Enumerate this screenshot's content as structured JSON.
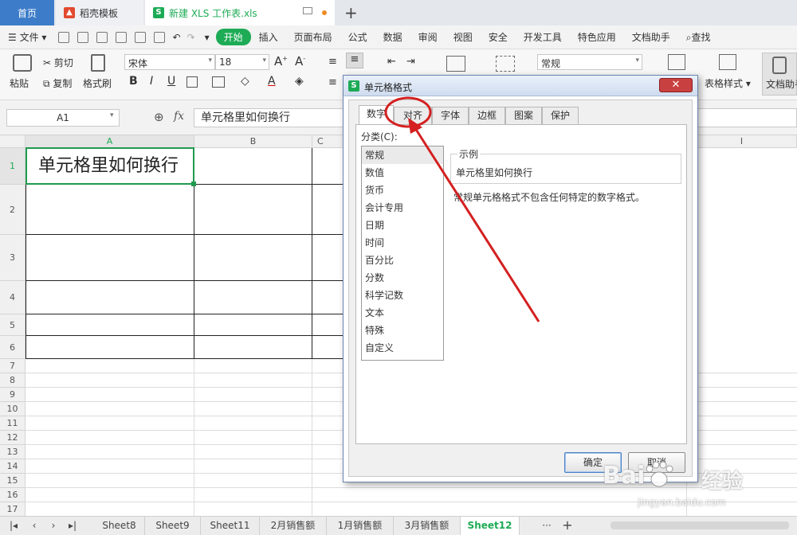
{
  "tabs": [
    {
      "label": "首页"
    },
    {
      "label": "稻壳模板"
    },
    {
      "label": "新建 XLS 工作表.xls"
    }
  ],
  "menu": {
    "file": "文件",
    "items": [
      "开始",
      "插入",
      "页面布局",
      "公式",
      "数据",
      "审阅",
      "视图",
      "安全",
      "开发工具",
      "特色应用",
      "文档助手"
    ],
    "search": "查找"
  },
  "ribbon": {
    "paste": "粘贴",
    "cut": "剪切",
    "copy": "复制",
    "format_painter": "格式刷",
    "font_name": "宋体",
    "font_size": "18",
    "bold": "B",
    "italic": "I",
    "underline": "U",
    "number_format": "常规",
    "table_style": "表格样式",
    "doc_helper": "文档助手"
  },
  "formula_bar": {
    "name_box": "A1",
    "fx": "fx",
    "content": "单元格里如何换行"
  },
  "grid": {
    "columns": [
      "A",
      "B",
      "C",
      "I"
    ],
    "rows": [
      "1",
      "2",
      "3",
      "4",
      "5",
      "6",
      "7",
      "8",
      "9",
      "10",
      "11",
      "12",
      "13",
      "14",
      "15",
      "16",
      "17"
    ],
    "a1_value": "单元格里如何换行"
  },
  "sheets": [
    "Sheet8",
    "Sheet9",
    "Sheet11",
    "2月销售额",
    "1月销售额",
    "3月销售额",
    "Sheet12"
  ],
  "dialog": {
    "title": "单元格格式",
    "close": "✕",
    "tabs": [
      "数字",
      "对齐",
      "字体",
      "边框",
      "图案",
      "保护"
    ],
    "category_label": "分类(C):",
    "categories": [
      "常规",
      "数值",
      "货币",
      "会计专用",
      "日期",
      "时间",
      "百分比",
      "分数",
      "科学记数",
      "文本",
      "特殊",
      "自定义"
    ],
    "sample_label": "示例",
    "sample_value": "单元格里如何换行",
    "description": "常规单元格格式不包含任何特定的数字格式。",
    "ok": "确定",
    "cancel": "取消"
  },
  "watermark": {
    "brand": "Bai",
    "brand_cn": "经验",
    "url": "jingyan.baidu.com"
  },
  "colors": {
    "accent": "#1dab55",
    "home_tab": "#3d7cc9",
    "annotation": "#d42020"
  }
}
